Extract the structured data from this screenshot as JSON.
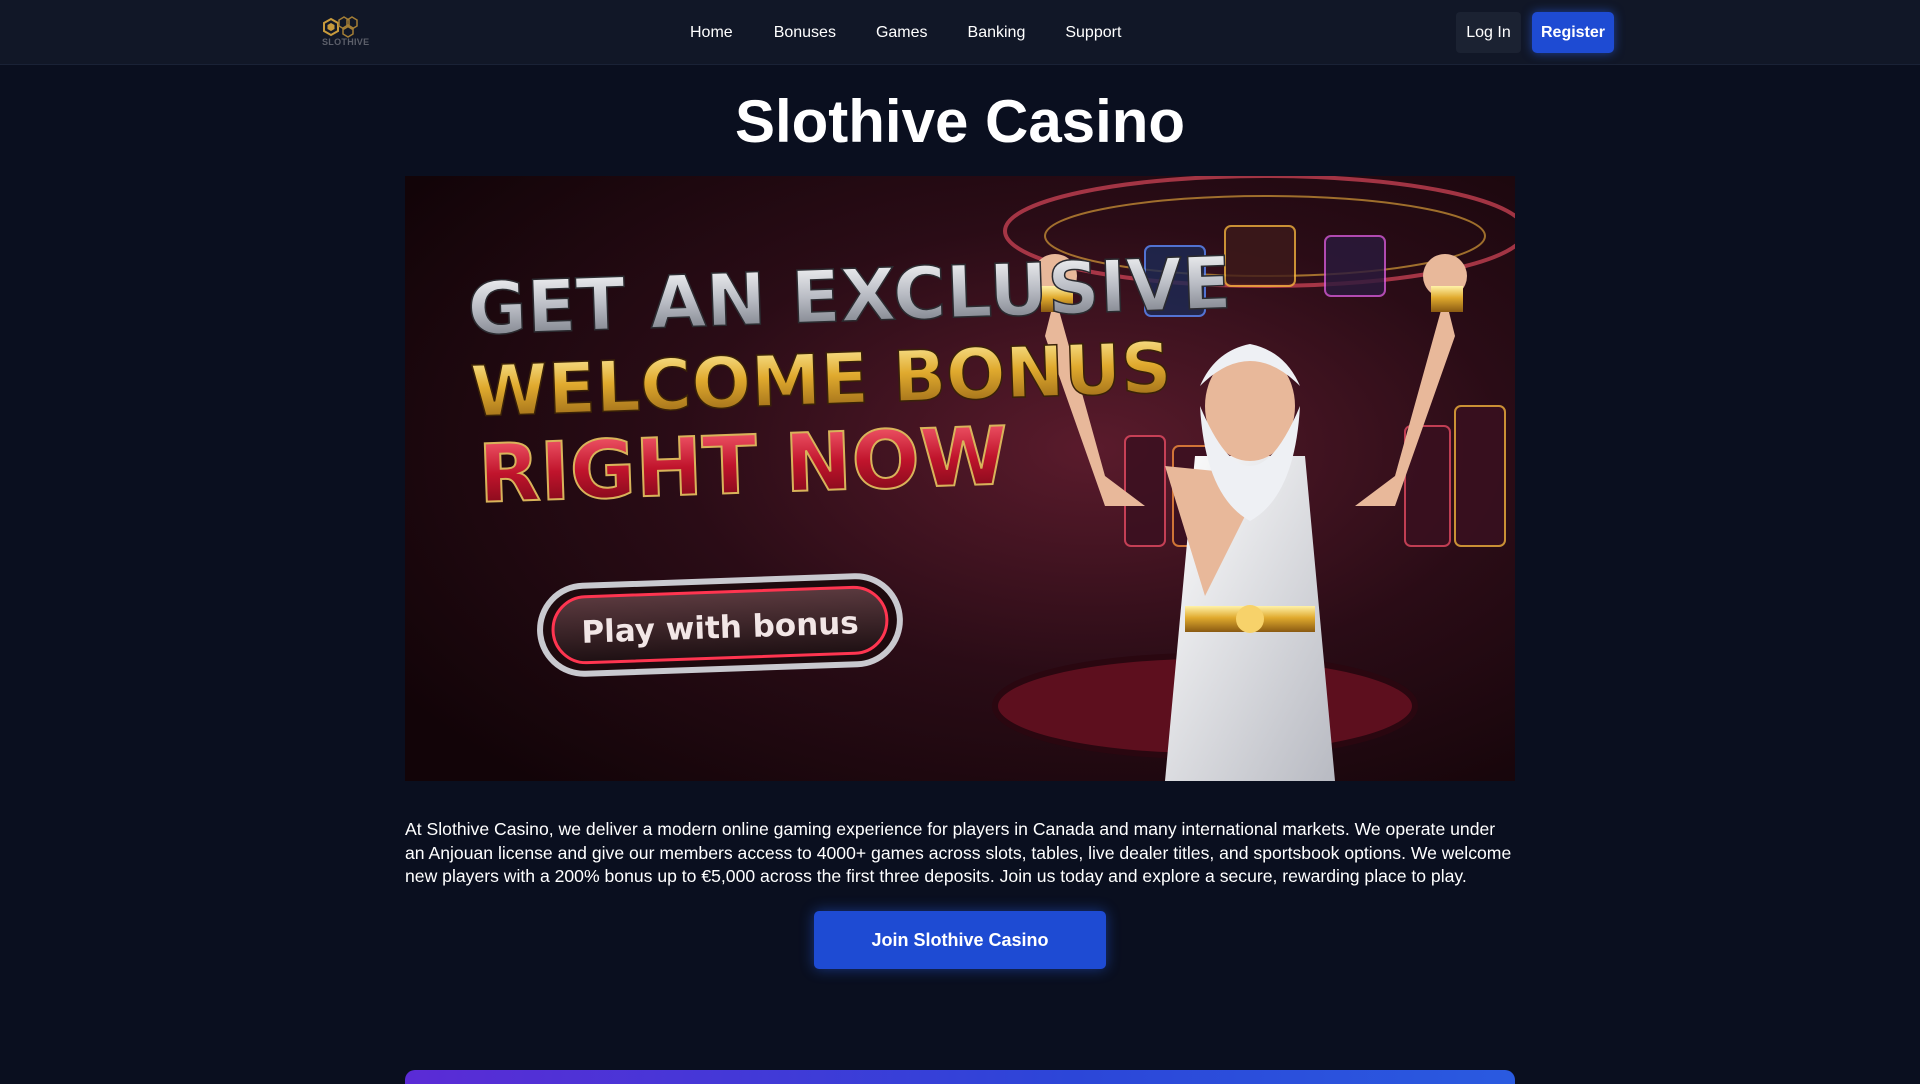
{
  "header": {
    "logo_text": "SLOTHIVE",
    "nav": [
      {
        "label": "Home"
      },
      {
        "label": "Bonuses"
      },
      {
        "label": "Games"
      },
      {
        "label": "Banking"
      },
      {
        "label": "Support"
      }
    ],
    "login_label": "Log In",
    "register_label": "Register"
  },
  "main": {
    "title": "Slothive Casino",
    "banner": {
      "line1": "GET AN EXCLUSIVE",
      "line2": "WELCOME BONUS",
      "line3": "RIGHT NOW",
      "button_label": "Play with bonus"
    },
    "intro": "At Slothive Casino, we deliver a modern online gaming experience for players in Canada and many international markets. We operate under an Anjouan license and give our members access to 4000+ games across slots, tables, live dealer titles, and sportsbook options. We welcome new players with a 200% bonus up to €5,000 across the first three deposits. Join us today and explore a secure, rewarding place to play.",
    "cta_label": "Join Slothive Casino"
  },
  "colors": {
    "background": "#0a0f1f",
    "header_bg": "#111727",
    "accent": "#1e4bd3"
  }
}
